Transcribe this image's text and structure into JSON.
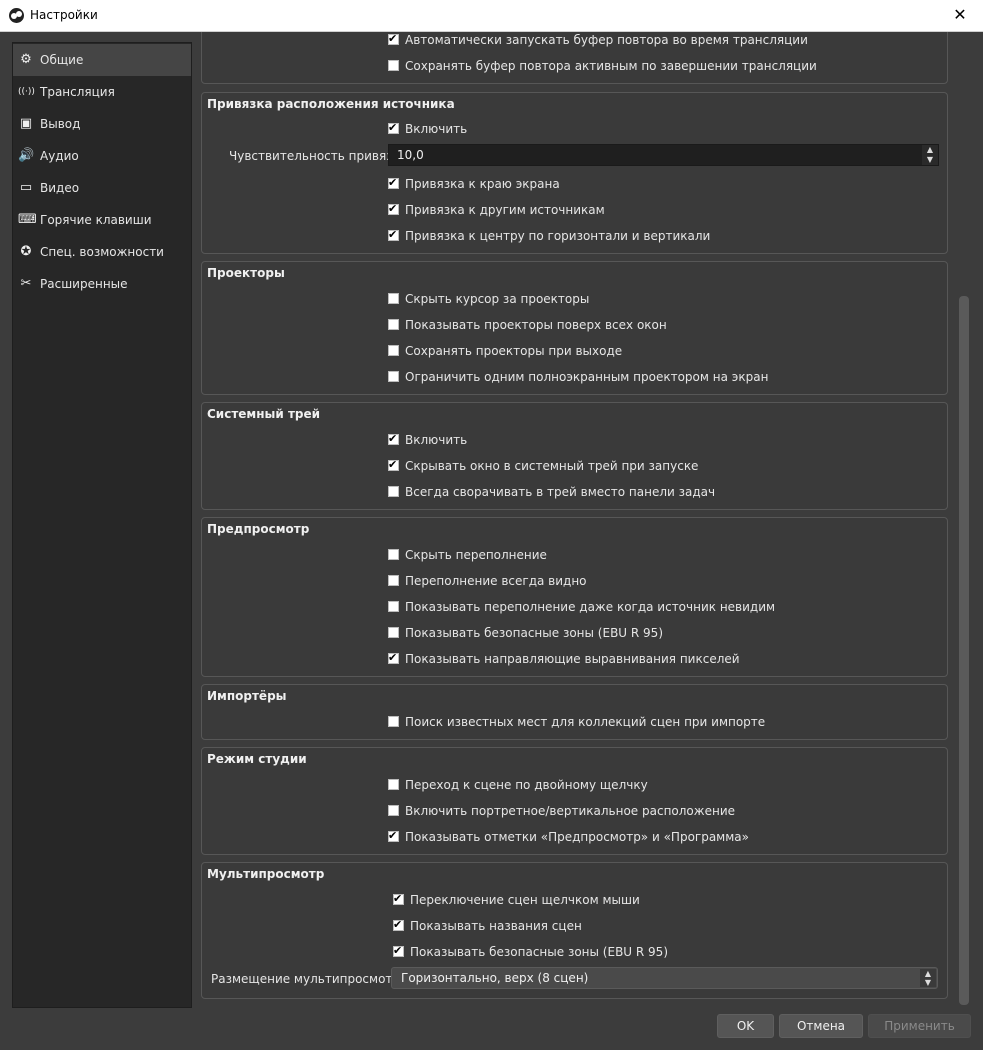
{
  "window": {
    "title": "Настройки",
    "close_glyph": "✕"
  },
  "sidebar": {
    "items": [
      {
        "label": "Общие",
        "icon": "⚙",
        "icon_name": "gear-icon",
        "active": true
      },
      {
        "label": "Трансляция",
        "icon": "((·))",
        "icon_name": "broadcast-icon"
      },
      {
        "label": "Вывод",
        "icon": "▣",
        "icon_name": "output-icon"
      },
      {
        "label": "Аудио",
        "icon": "🔊",
        "icon_name": "speaker-icon"
      },
      {
        "label": "Видео",
        "icon": "▭",
        "icon_name": "monitor-icon"
      },
      {
        "label": "Горячие клавиши",
        "icon": "⌨",
        "icon_name": "keyboard-icon"
      },
      {
        "label": "Спец. возможности",
        "icon": "✪",
        "icon_name": "accessibility-icon"
      },
      {
        "label": "Расширенные",
        "icon": "✂",
        "icon_name": "tools-icon"
      }
    ]
  },
  "replay": {
    "partial_label": "Автоматически запускать буфер повтора во время трансляции",
    "keep_active_label": "Сохранять буфер повтора активным по завершении трансляции"
  },
  "snapping": {
    "title": "Привязка расположения источника",
    "enable": "Включить",
    "sensitivity_label": "Чувствительность привязки",
    "sensitivity_value": "10,0",
    "edge": "Привязка к краю экрана",
    "sources": "Привязка к другим источникам",
    "center": "Привязка к центру по горизонтали и вертикали"
  },
  "projectors": {
    "title": "Проекторы",
    "hide_cursor": "Скрыть курсор за проекторы",
    "on_top": "Показывать проекторы поверх всех окон",
    "save_on_exit": "Сохранять проекторы при выходе",
    "limit_one": "Ограничить одним полноэкранным проектором на экран"
  },
  "tray": {
    "title": "Системный трей",
    "enable": "Включить",
    "minimize_start": "Скрывать окно в системный трей при запуске",
    "always_minimize": "Всегда сворачивать в трей вместо панели задач"
  },
  "preview": {
    "title": "Предпросмотр",
    "hide_overflow": "Скрыть переполнение",
    "overflow_visible": "Переполнение всегда видно",
    "overflow_hidden_source": "Показывать переполнение даже когда источник невидим",
    "safe_zones": "Показывать безопасные зоны (EBU R 95)",
    "pixel_guides": "Показывать направляющие выравнивания пикселей"
  },
  "importers": {
    "title": "Импортёры",
    "search_known": "Поиск известных мест для коллекций сцен при импорте"
  },
  "studio": {
    "title": "Режим студии",
    "double_click": "Переход к сцене по двойному щелчку",
    "portrait": "Включить портретное/вертикальное расположение",
    "labels": "Показывать отметки «Предпросмотр» и «Программа»"
  },
  "multiview": {
    "title": "Мультипросмотр",
    "click_switch": "Переключение сцен щелчком мыши",
    "scene_names": "Показывать названия сцен",
    "safe_zones": "Показывать безопасные зоны (EBU R 95)",
    "layout_label": "Размещение мультипросмотра",
    "layout_value": "Горизонтально, верх (8 сцен)"
  },
  "buttons": {
    "ok": "OK",
    "cancel": "Отмена",
    "apply": "Применить"
  }
}
